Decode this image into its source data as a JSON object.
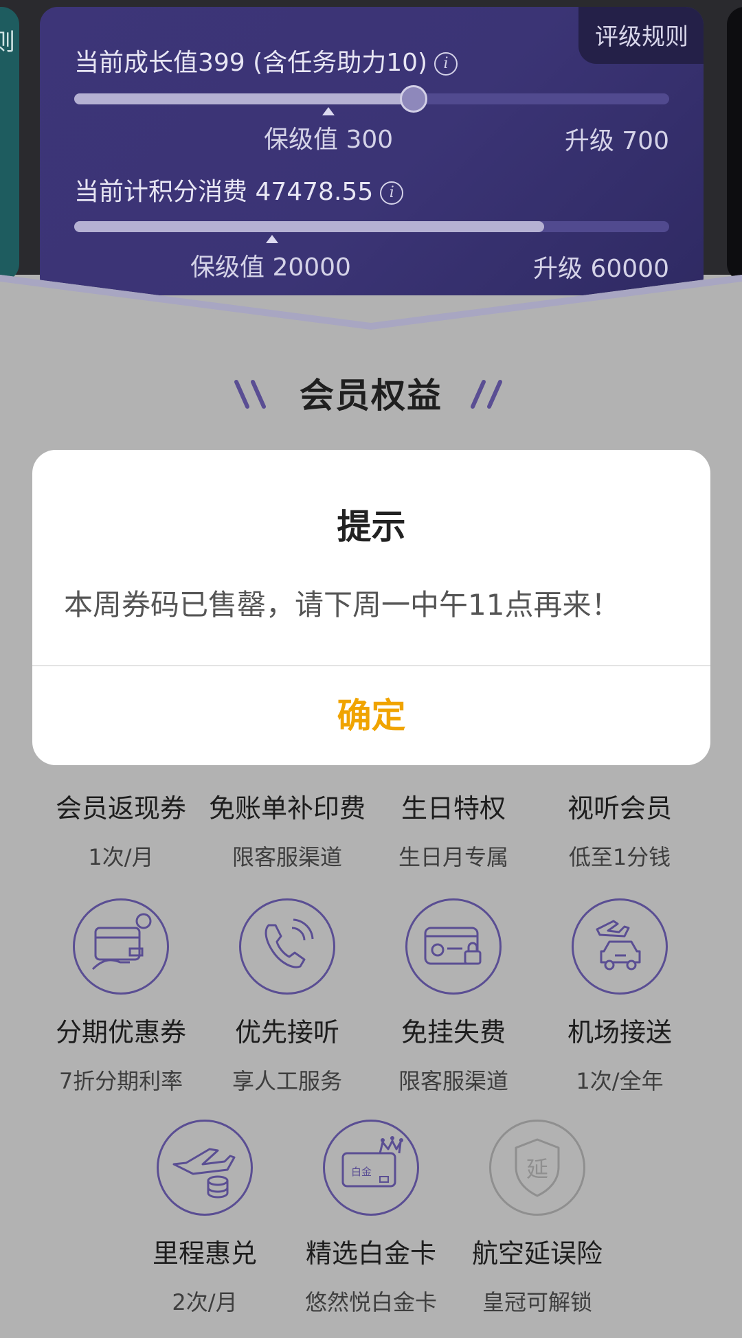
{
  "card": {
    "rule_tag": "评级规则",
    "growth": {
      "label": "当前成长值399 (含任务助力10)",
      "current": 399,
      "progress_fraction": 0.57,
      "keep_label": "保级值 300",
      "upgrade_label": "升级 700"
    },
    "spend": {
      "label": "当前计积分消费 47478.55",
      "current": 47478.55,
      "progress_fraction": 0.79,
      "keep_label": "保级值 20000",
      "upgrade_label": "升级 60000"
    },
    "left_peek_text": "则"
  },
  "benefits": {
    "title": "会员权益",
    "items": [
      {
        "name": "会员返现券",
        "sub": "1次/月"
      },
      {
        "name": "免账单补印费",
        "sub": "限客服渠道"
      },
      {
        "name": "生日特权",
        "sub": "生日月专属"
      },
      {
        "name": "视听会员",
        "sub": "低至1分钱"
      },
      {
        "name": "分期优惠券",
        "sub": "7折分期利率",
        "icon": "installment-card-icon"
      },
      {
        "name": "优先接听",
        "sub": "享人工服务",
        "icon": "phone-icon"
      },
      {
        "name": "免挂失费",
        "sub": "限客服渠道",
        "icon": "card-lock-icon"
      },
      {
        "name": "机场接送",
        "sub": "1次/全年",
        "icon": "airport-car-icon"
      },
      {
        "name": "里程惠兑",
        "sub": "2次/月",
        "icon": "plane-coins-icon"
      },
      {
        "name": "精选白金卡",
        "sub": "悠然悦白金卡",
        "icon": "platinum-card-icon",
        "icon_text": "白金"
      },
      {
        "name": "航空延误险",
        "sub": "皇冠可解锁",
        "icon": "delay-shield-icon",
        "icon_text": "延",
        "locked": true
      }
    ]
  },
  "dialog": {
    "title": "提示",
    "message": "本周券码已售罄，请下周一中午11点再来！",
    "confirm": "确定"
  },
  "colors": {
    "card_bg": "#3d3578",
    "accent_purple": "#5a4e93",
    "confirm_orange": "#f0a400",
    "overlay_gray": "#b2b2b2"
  }
}
